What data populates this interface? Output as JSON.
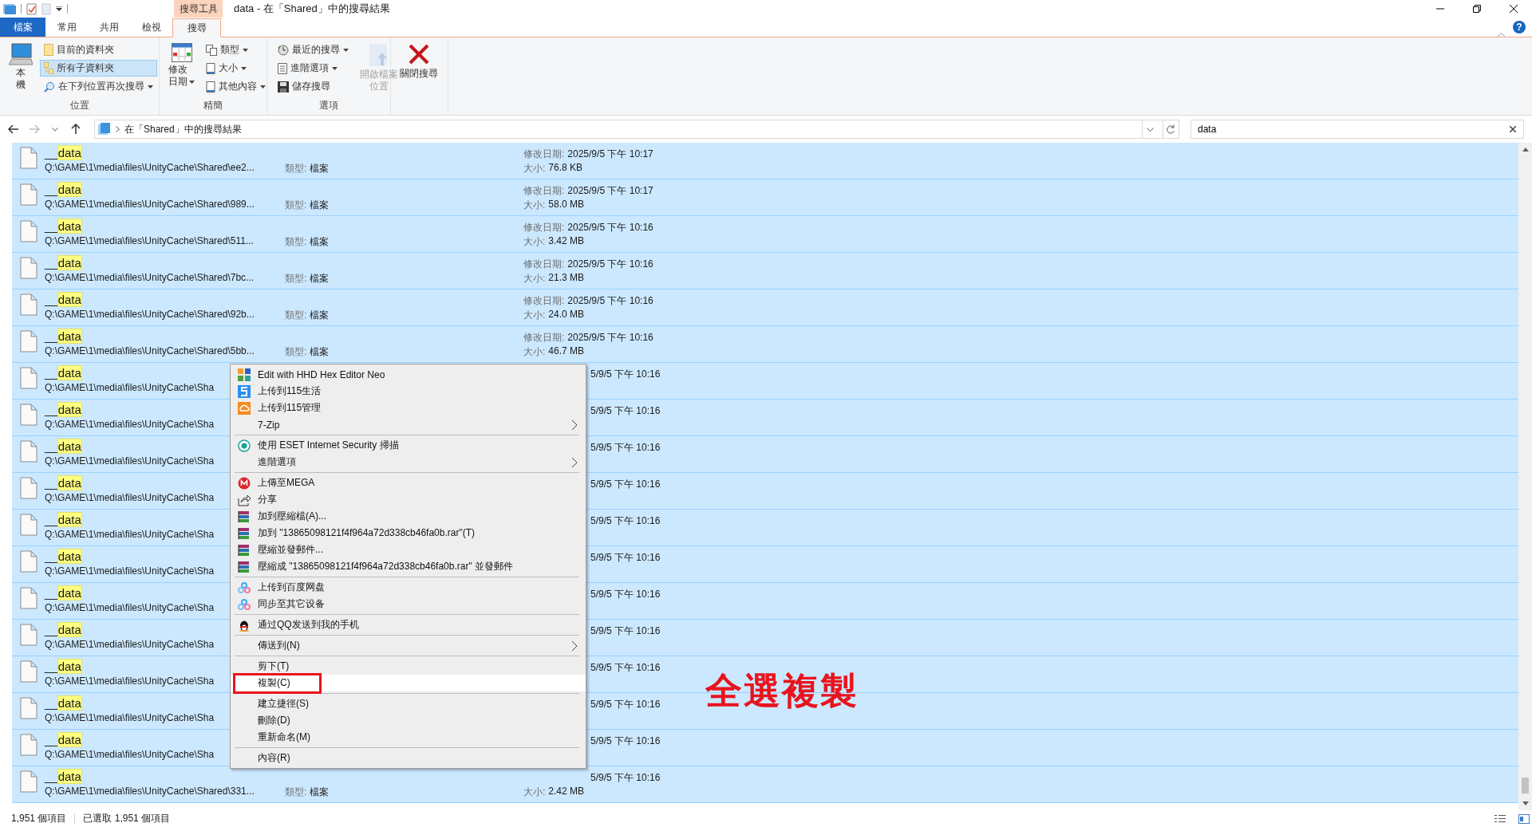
{
  "window": {
    "title": "data - 在「Shared」中的搜尋結果",
    "contextual_tab": "搜尋工具"
  },
  "tabs": [
    {
      "label": "檔案",
      "kind": "file",
      "selected": false
    },
    {
      "label": "常用",
      "kind": "tab",
      "selected": false
    },
    {
      "label": "共用",
      "kind": "tab",
      "selected": false
    },
    {
      "label": "檢視",
      "kind": "tab",
      "selected": false
    },
    {
      "label": "搜尋",
      "kind": "tab",
      "selected": true
    }
  ],
  "help": "?",
  "ribbon": {
    "location": {
      "label": "位置",
      "this_pc": "本機",
      "current_folder": {
        "label": "目前的資料夾",
        "selected": false
      },
      "all_subfolders": {
        "label": "所有子資料夾",
        "selected": true
      },
      "search_again": "在下列位置再次搜尋"
    },
    "refine": {
      "label": "精簡",
      "date_modified": "修改日期",
      "type_filter": "類型",
      "size": "大小",
      "other": "其他內容"
    },
    "options": {
      "label": "選項",
      "recent": "最近的搜尋",
      "advanced": "進階選項",
      "save": "儲存搜尋",
      "open_location": {
        "label": "開啟檔案位置",
        "disabled": true
      }
    },
    "close": "關閉搜尋"
  },
  "address": {
    "path": "在「Shared」中的搜尋結果"
  },
  "search": {
    "value": "data"
  },
  "rows": [
    {
      "name_lead": "__",
      "name_match": "data",
      "path": "Q:\\GAME\\1\\media\\files\\UnityCache\\Shared\\ee2...",
      "type_label": "類型:",
      "type": "檔案",
      "date_label": "修改日期:",
      "date": "2025/9/5 下午 10:17",
      "size_label": "大小:",
      "size": "76.8 KB",
      "selected": true
    },
    {
      "name_lead": "__",
      "name_match": "data",
      "path": "Q:\\GAME\\1\\media\\files\\UnityCache\\Shared\\989...",
      "type_label": "類型:",
      "type": "檔案",
      "date_label": "修改日期:",
      "date": "2025/9/5 下午 10:17",
      "size_label": "大小:",
      "size": "58.0 MB",
      "selected": true
    },
    {
      "name_lead": "__",
      "name_match": "data",
      "path": "Q:\\GAME\\1\\media\\files\\UnityCache\\Shared\\511...",
      "type_label": "類型:",
      "type": "檔案",
      "date_label": "修改日期:",
      "date": "2025/9/5 下午 10:16",
      "size_label": "大小:",
      "size": "3.42 MB",
      "selected": true
    },
    {
      "name_lead": "__",
      "name_match": "data",
      "path": "Q:\\GAME\\1\\media\\files\\UnityCache\\Shared\\7bc...",
      "type_label": "類型:",
      "type": "檔案",
      "date_label": "修改日期:",
      "date": "2025/9/5 下午 10:16",
      "size_label": "大小:",
      "size": "21.3 MB",
      "selected": true
    },
    {
      "name_lead": "__",
      "name_match": "data",
      "path": "Q:\\GAME\\1\\media\\files\\UnityCache\\Shared\\92b...",
      "type_label": "類型:",
      "type": "檔案",
      "date_label": "修改日期:",
      "date": "2025/9/5 下午 10:16",
      "size_label": "大小:",
      "size": "24.0 MB",
      "selected": true
    },
    {
      "name_lead": "__",
      "name_match": "data",
      "path": "Q:\\GAME\\1\\media\\files\\UnityCache\\Shared\\5bb...",
      "type_label": "類型:",
      "type": "檔案",
      "date_label": "修改日期:",
      "date": "2025/9/5 下午 10:16",
      "size_label": "大小:",
      "size": "46.7 MB",
      "selected": true
    },
    {
      "name_lead": "__",
      "name_match": "data",
      "path": "Q:\\GAME\\1\\media\\files\\UnityCache\\Sha",
      "date": "5/9/5 下午 10:16",
      "selected": true
    },
    {
      "name_lead": "__",
      "name_match": "data",
      "path": "Q:\\GAME\\1\\media\\files\\UnityCache\\Sha",
      "date": "5/9/5 下午 10:16",
      "selected": true
    },
    {
      "name_lead": "__",
      "name_match": "data",
      "path": "Q:\\GAME\\1\\media\\files\\UnityCache\\Sha",
      "date": "5/9/5 下午 10:16",
      "selected": true
    },
    {
      "name_lead": "__",
      "name_match": "data",
      "path": "Q:\\GAME\\1\\media\\files\\UnityCache\\Sha",
      "date": "5/9/5 下午 10:16",
      "selected": true
    },
    {
      "name_lead": "__",
      "name_match": "data",
      "path": "Q:\\GAME\\1\\media\\files\\UnityCache\\Sha",
      "date": "5/9/5 下午 10:16",
      "selected": true
    },
    {
      "name_lead": "__",
      "name_match": "data",
      "path": "Q:\\GAME\\1\\media\\files\\UnityCache\\Sha",
      "date": "5/9/5 下午 10:16",
      "selected": true
    },
    {
      "name_lead": "__",
      "name_match": "data",
      "path": "Q:\\GAME\\1\\media\\files\\UnityCache\\Sha",
      "date": "5/9/5 下午 10:16",
      "selected": true
    },
    {
      "name_lead": "__",
      "name_match": "data",
      "path": "Q:\\GAME\\1\\media\\files\\UnityCache\\Sha",
      "date": "5/9/5 下午 10:16",
      "selected": true
    },
    {
      "name_lead": "__",
      "name_match": "data",
      "path": "Q:\\GAME\\1\\media\\files\\UnityCache\\Sha",
      "date": "5/9/5 下午 10:16",
      "selected": true
    },
    {
      "name_lead": "__",
      "name_match": "data",
      "path": "Q:\\GAME\\1\\media\\files\\UnityCache\\Sha",
      "date": "5/9/5 下午 10:16",
      "selected": true
    },
    {
      "name_lead": "__",
      "name_match": "data",
      "path": "Q:\\GAME\\1\\media\\files\\UnityCache\\Sha",
      "date": "5/9/5 下午 10:16",
      "selected": true
    },
    {
      "name_lead": "__",
      "name_match": "data",
      "path": "Q:\\GAME\\1\\media\\files\\UnityCache\\Shared\\331...",
      "type_label": "類型:",
      "type": "檔案",
      "date": "5/9/5 下午 10:16",
      "size_label": "大小:",
      "size": "2.42 MB",
      "selected": true
    }
  ],
  "context_menu": {
    "groups": [
      [
        {
          "label": "Edit with HHD Hex Editor Neo",
          "submenu": false,
          "highlighted": false,
          "annotated": false
        },
        {
          "label": "上传到115生活",
          "submenu": false,
          "highlighted": false,
          "annotated": false
        },
        {
          "label": "上传到115管理",
          "submenu": false,
          "highlighted": false,
          "annotated": false
        },
        {
          "label": "7-Zip",
          "submenu": true,
          "highlighted": false,
          "annotated": false
        }
      ],
      [
        {
          "label": "使用 ESET Internet Security 掃描",
          "submenu": false,
          "highlighted": false,
          "annotated": false
        },
        {
          "label": "進階選項",
          "submenu": true,
          "highlighted": false,
          "annotated": false
        }
      ],
      [
        {
          "label": "上傳至MEGA",
          "submenu": false,
          "highlighted": false,
          "annotated": false
        },
        {
          "label": "分享",
          "submenu": false,
          "highlighted": false,
          "annotated": false
        },
        {
          "label": "加到壓縮檔(A)...",
          "submenu": false,
          "highlighted": false,
          "annotated": false
        },
        {
          "label": "加到 \"13865098121f4f964a72d338cb46fa0b.rar\"(T)",
          "submenu": false,
          "highlighted": false,
          "annotated": false
        },
        {
          "label": "壓縮並發郵件...",
          "submenu": false,
          "highlighted": false,
          "annotated": false
        },
        {
          "label": "壓縮成 \"13865098121f4f964a72d338cb46fa0b.rar\" 並發郵件",
          "submenu": false,
          "highlighted": false,
          "annotated": false
        }
      ],
      [
        {
          "label": "上传到百度网盘",
          "submenu": false,
          "highlighted": false,
          "annotated": false
        },
        {
          "label": "同步至其它设备",
          "submenu": false,
          "highlighted": false,
          "annotated": false
        }
      ],
      [
        {
          "label": "通过QQ发送到我的手机",
          "submenu": false,
          "highlighted": false,
          "annotated": false
        }
      ],
      [
        {
          "label": "傳送到(N)",
          "submenu": true,
          "highlighted": false,
          "annotated": false
        }
      ],
      [
        {
          "label": "剪下(T)",
          "submenu": false,
          "highlighted": false,
          "annotated": false
        },
        {
          "label": "複製(C)",
          "submenu": false,
          "highlighted": true,
          "annotated": true
        }
      ],
      [
        {
          "label": "建立捷徑(S)",
          "submenu": false,
          "highlighted": false,
          "annotated": false
        },
        {
          "label": "刪除(D)",
          "submenu": false,
          "highlighted": false,
          "annotated": false
        },
        {
          "label": "重新命名(M)",
          "submenu": false,
          "highlighted": false,
          "annotated": false
        }
      ],
      [
        {
          "label": "內容(R)",
          "submenu": false,
          "highlighted": false,
          "annotated": false
        }
      ]
    ]
  },
  "annotation": {
    "text": "全選複製"
  },
  "status_bar": {
    "count": "1,951 個項目",
    "selected": "已選取 1,951 個項目"
  }
}
